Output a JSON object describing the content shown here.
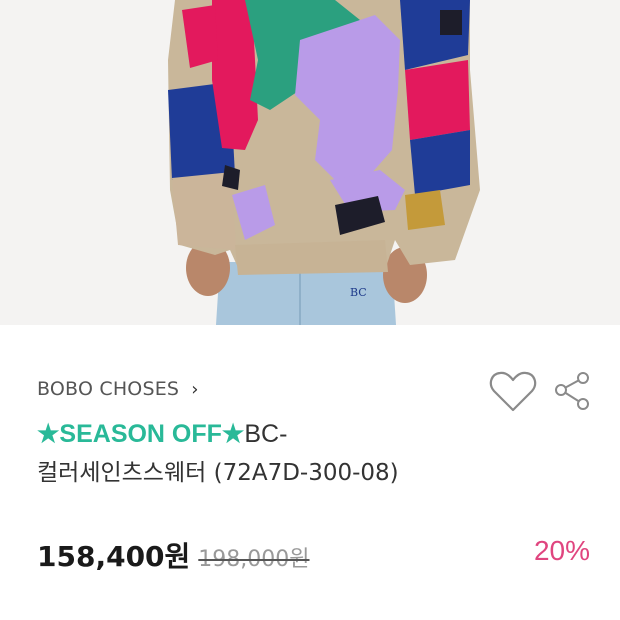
{
  "product": {
    "brand": "BOBO CHOSES",
    "brand_chevron": "›",
    "title_promo": "★SEASON OFF★",
    "title_code": "BC-",
    "title_line2": "컬러세인츠스웨터 (72A7D-300-08)",
    "price": "158,400원",
    "original_price": "198,000원",
    "discount": "20%",
    "photo_patch_text": "BC"
  },
  "icons": {
    "wishlist": "heart-icon",
    "share": "share-icon"
  },
  "colors": {
    "promo_green": "#29b998",
    "discount_pink": "#e0457f"
  }
}
